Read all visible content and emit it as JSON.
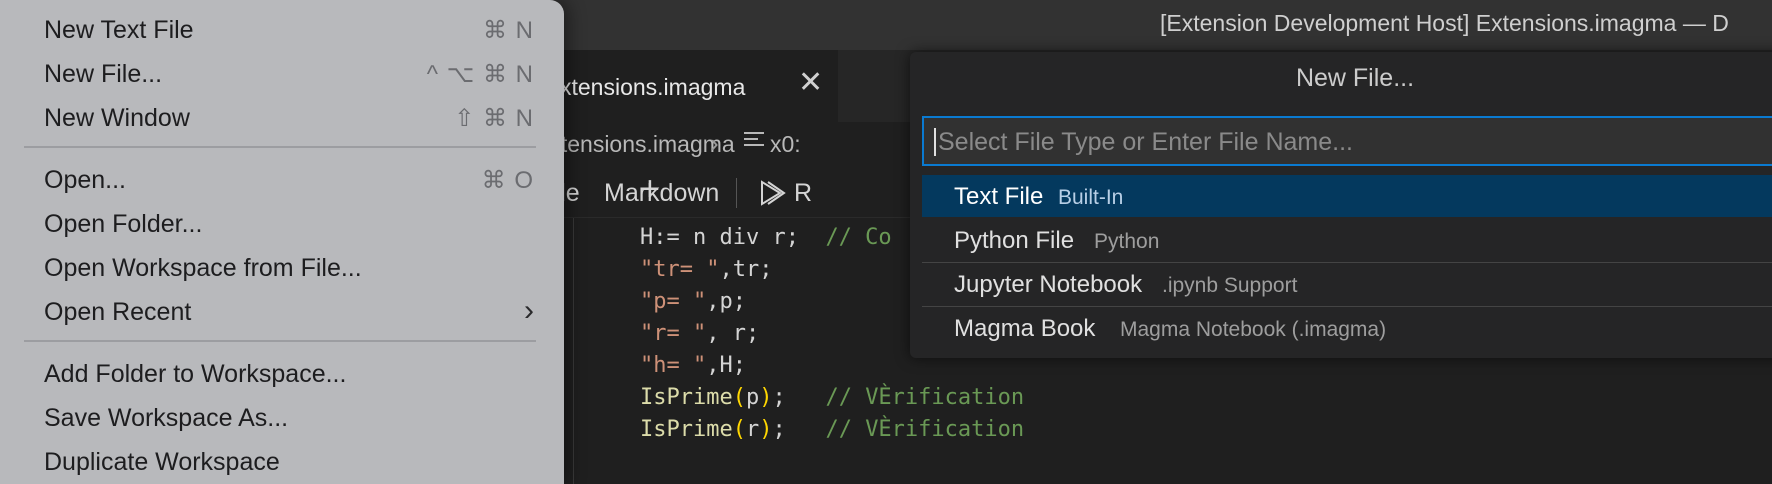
{
  "window": {
    "title": "[Extension Development Host] Extensions.imagma — D"
  },
  "tab": {
    "label": "xtensions.imagma",
    "close_glyph": "✕"
  },
  "breadcrumb": {
    "file": "Extensions.imagma",
    "separator": "›",
    "symbol": "x0:"
  },
  "toolbar": {
    "code_label": "ode",
    "markdown_label": "Markdown",
    "run_label": "R"
  },
  "code": {
    "lines": [
      {
        "parts": [
          {
            "t": "H:= n div r;  ",
            "c": ""
          },
          {
            "t": "// Co",
            "c": "cmt"
          }
        ]
      },
      {
        "parts": [
          {
            "t": "\"tr= \"",
            "c": "str"
          },
          {
            "t": ",tr;",
            "c": ""
          }
        ]
      },
      {
        "parts": [
          {
            "t": "\"p= \"",
            "c": "str"
          },
          {
            "t": ",p;",
            "c": ""
          }
        ]
      },
      {
        "parts": [
          {
            "t": "\"r= \"",
            "c": "str"
          },
          {
            "t": ", r;",
            "c": ""
          }
        ]
      },
      {
        "parts": [
          {
            "t": "\"h= \"",
            "c": "str"
          },
          {
            "t": ",H;",
            "c": ""
          }
        ]
      },
      {
        "parts": [
          {
            "t": "IsPrime",
            "c": "fn"
          },
          {
            "t": "(",
            "c": "paren"
          },
          {
            "t": "p",
            "c": ""
          },
          {
            "t": ")",
            "c": "paren"
          },
          {
            "t": ";   ",
            "c": ""
          },
          {
            "t": "// VÈrification",
            "c": "cmt"
          }
        ]
      },
      {
        "parts": [
          {
            "t": "IsPrime",
            "c": "fn"
          },
          {
            "t": "(",
            "c": "paren"
          },
          {
            "t": "r",
            "c": ""
          },
          {
            "t": ")",
            "c": "paren"
          },
          {
            "t": ";   ",
            "c": ""
          },
          {
            "t": "// VÈrification",
            "c": "cmt"
          }
        ]
      }
    ]
  },
  "menu": {
    "groups": [
      [
        {
          "label": "New Text File",
          "shortcut": "⌘ N"
        },
        {
          "label": "New File...",
          "shortcut": "^ ⌥ ⌘ N"
        },
        {
          "label": "New Window",
          "shortcut": "⇧ ⌘ N"
        }
      ],
      [
        {
          "label": "Open...",
          "shortcut": "⌘ O"
        },
        {
          "label": "Open Folder...",
          "shortcut": ""
        },
        {
          "label": "Open Workspace from File...",
          "shortcut": ""
        },
        {
          "label": "Open Recent",
          "shortcut": "",
          "submenu": true
        }
      ],
      [
        {
          "label": "Add Folder to Workspace...",
          "shortcut": ""
        },
        {
          "label": "Save Workspace As...",
          "shortcut": ""
        },
        {
          "label": "Duplicate Workspace",
          "shortcut": ""
        }
      ]
    ],
    "submenu_glyph": "›"
  },
  "quickpick": {
    "title": "New File...",
    "placeholder": "Select File Type or Enter File Name...",
    "items": [
      {
        "label": "Text File",
        "description": "Built-In",
        "active": true
      },
      {
        "label": "Python File",
        "description": "Python",
        "active": false
      },
      {
        "label": "Jupyter Notebook",
        "description": ".ipynb Support",
        "active": false
      },
      {
        "label": "Magma Book",
        "description": "Magma Notebook (.imagma)",
        "active": false
      }
    ]
  },
  "colors": {
    "accent": "#0a7ad1",
    "selection": "#04395e"
  }
}
